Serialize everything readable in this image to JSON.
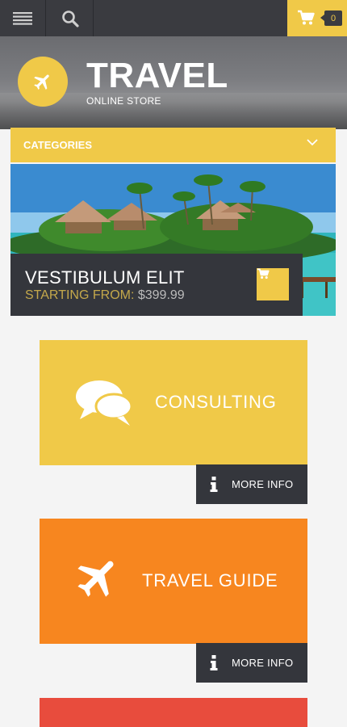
{
  "topbar": {
    "menu_icon": "hamburger-menu-icon",
    "search_icon": "search-icon",
    "cart_icon": "shopping-cart-icon",
    "cart_count": "0",
    "accent_color": "#f0c948",
    "bar_color": "#3a3b40"
  },
  "header": {
    "logo_icon": "airplane-icon",
    "title": "TRAVEL",
    "subtitle": "ONLINE STORE"
  },
  "categories": {
    "label": "CATEGORIES",
    "icon": "chevron-down-icon"
  },
  "banner": {
    "title": "VESTIBULUM ELIT",
    "price_label": "STARTING FROM:",
    "price": "$399.99",
    "cart_icon": "shopping-cart-icon"
  },
  "tiles": [
    {
      "label": "CONSULTING",
      "icon": "speech-bubbles-icon",
      "color": "#f0c948",
      "more": "MORE INFO",
      "more_icon": "info-icon"
    },
    {
      "label": "TRAVEL GUIDE",
      "icon": "airplane-icon",
      "color": "#f7861f",
      "more": "MORE INFO",
      "more_icon": "info-icon"
    },
    {
      "color": "#e84c3d"
    }
  ]
}
